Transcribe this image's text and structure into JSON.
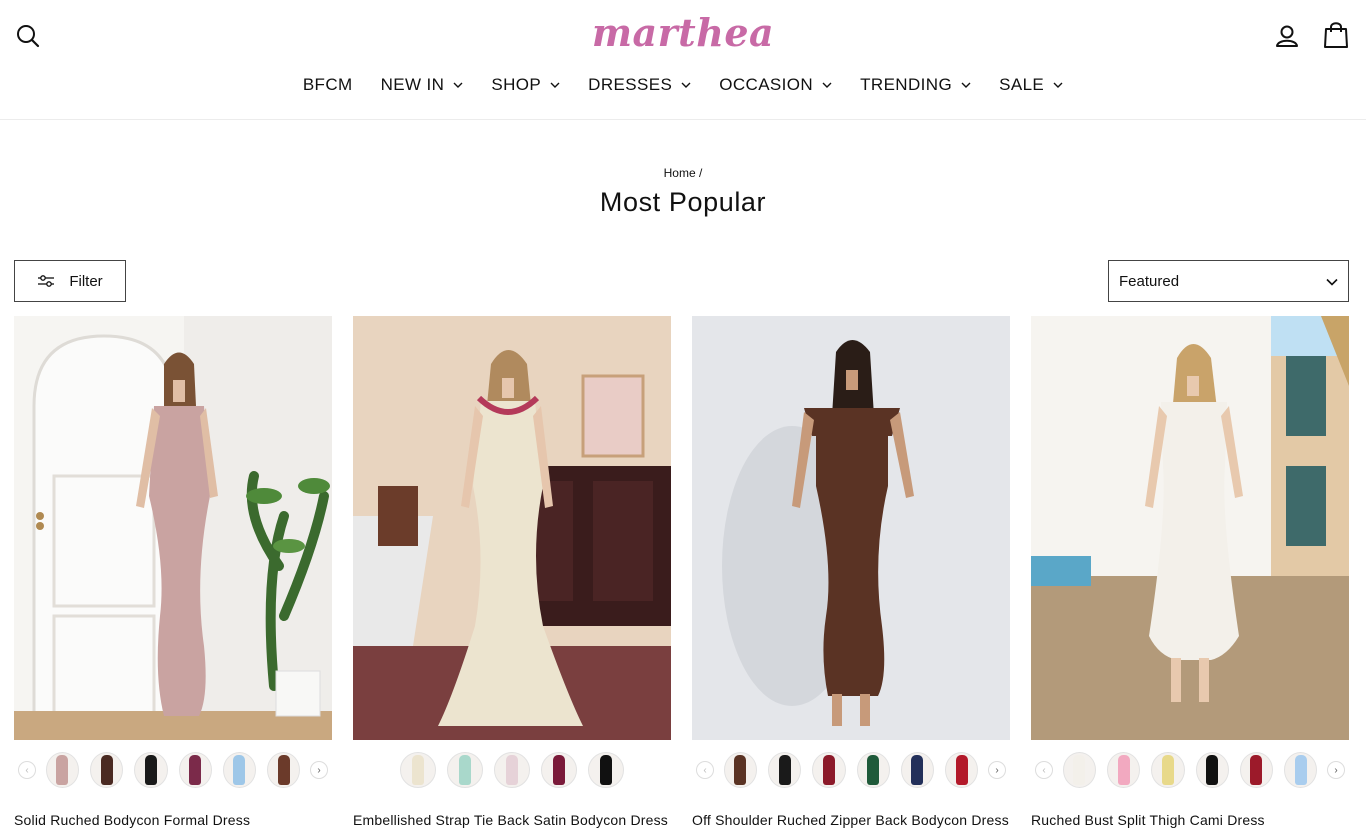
{
  "brand": {
    "logo_text": "marthea",
    "logo_color": "#c86aa6"
  },
  "header": {
    "icons": [
      "search-icon",
      "account-icon",
      "cart-icon"
    ],
    "nav": [
      {
        "label": "BFCM",
        "has_dropdown": false
      },
      {
        "label": "NEW IN",
        "has_dropdown": true
      },
      {
        "label": "SHOP",
        "has_dropdown": true
      },
      {
        "label": "DRESSES",
        "has_dropdown": true
      },
      {
        "label": "OCCASION",
        "has_dropdown": true
      },
      {
        "label": "TRENDING",
        "has_dropdown": true
      },
      {
        "label": "SALE",
        "has_dropdown": true
      }
    ]
  },
  "breadcrumb": {
    "home": "Home",
    "separator": "/"
  },
  "page": {
    "title": "Most Popular"
  },
  "toolbar": {
    "filter_label": "Filter",
    "sort_value": "Featured"
  },
  "products": [
    {
      "title": "Solid Ruched Bodycon Formal Dress",
      "dress_color": "#c9a3a1",
      "swatches": [
        "#c9a3a1",
        "#4a2a22",
        "#1a1a1a",
        "#7b2a4a",
        "#9ec7e8",
        "#6b3a2a"
      ],
      "has_arrows": true
    },
    {
      "title": "Embellished Strap Tie Back Satin Bodycon Dress",
      "dress_color": "#ece4cf",
      "swatches": [
        "#ece4cf",
        "#a9d8cb",
        "#e6d2d8",
        "#7a1a3a",
        "#111111"
      ],
      "has_arrows": false
    },
    {
      "title": "Off Shoulder Ruched Zipper Back Bodycon Dress",
      "dress_color": "#5a3324",
      "swatches": [
        "#5a3324",
        "#1a1a1a",
        "#8c1a2a",
        "#1f5a3a",
        "#23305a",
        "#b3192a"
      ],
      "has_arrows": true
    },
    {
      "title": "Ruched Bust Split Thigh Cami Dress",
      "dress_color": "#f3f0ea",
      "swatches": [
        "#f3f0ea",
        "#f2a9c0",
        "#e8d98a",
        "#111111",
        "#9c1a2a",
        "#a9cdee"
      ],
      "has_arrows": true
    }
  ]
}
